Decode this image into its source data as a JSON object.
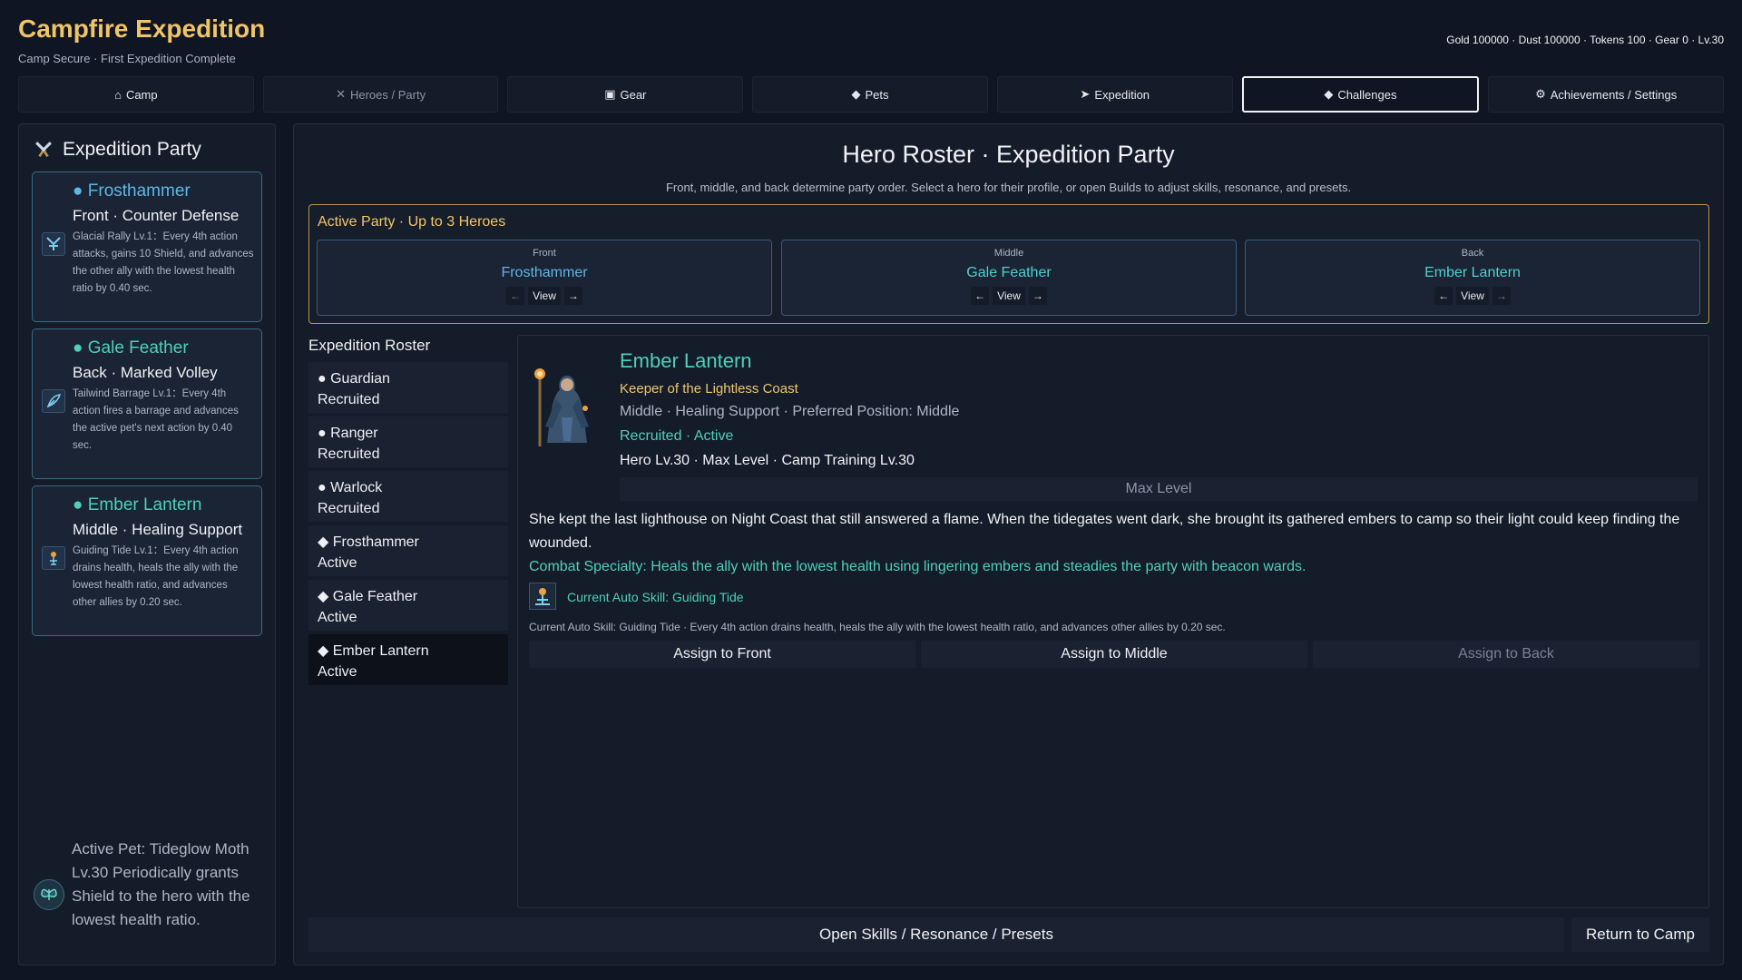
{
  "app": {
    "title": "Campfire Expedition",
    "subtitle": "Camp Secure · First Expedition Complete",
    "resources": "Gold 100000 · Dust 100000 · Tokens 100 · Gear 0 · Lv.30"
  },
  "nav": {
    "tabs": [
      {
        "icon": "⌂",
        "label": "Camp"
      },
      {
        "icon": "✕",
        "label": "Heroes / Party"
      },
      {
        "icon": "▣",
        "label": "Gear"
      },
      {
        "icon": "◆",
        "label": "Pets"
      },
      {
        "icon": "➤",
        "label": "Expedition"
      },
      {
        "icon": "◆",
        "label": "Challenges"
      },
      {
        "icon": "⚙",
        "label": "Achievements / Settings"
      }
    ],
    "active_tab": "Challenges"
  },
  "sidebar": {
    "title": "Expedition Party",
    "cards": [
      {
        "name": "● Frosthammer",
        "role": "Front · Counter Defense",
        "desc": "Glacial Rally Lv.1：Every 4th action attacks, gains 10 Shield, and advances the other ally with the lowest health ratio by 0.40 sec.",
        "icon": "frost-hammer-icon"
      },
      {
        "name": "● Gale Feather",
        "role": "Back · Marked Volley",
        "desc": "Tailwind Barrage Lv.1：Every 4th action fires a barrage and advances the active pet's next action by 0.40 sec.",
        "icon": "feather-icon"
      },
      {
        "name": "● Ember Lantern",
        "role": "Middle · Healing Support",
        "desc": "Guiding Tide Lv.1：Every 4th action drains health, heals the ally with the lowest health ratio, and advances other allies by 0.20 sec.",
        "icon": "lantern-icon"
      }
    ],
    "pet": {
      "text": "Active Pet: Tideglow Moth Lv.30 Periodically grants Shield to the hero with the lowest health ratio.",
      "icon": "moth-icon"
    }
  },
  "main": {
    "title": "Hero Roster · Expedition Party",
    "subtitle": "Front, middle, and back determine party order. Select a hero for their profile, or open Builds to adjust skills, resonance, and presets.",
    "active_party": {
      "title": "Active Party · Up to 3 Heroes",
      "slots": [
        {
          "label": "Front",
          "name": "Frosthammer",
          "left": "←",
          "view": "View",
          "right": "→"
        },
        {
          "label": "Middle",
          "name": "Gale Feather",
          "left": "←",
          "view": "View",
          "right": "→"
        },
        {
          "label": "Back",
          "name": "Ember Lantern",
          "left": "←",
          "view": "View",
          "right": "→"
        }
      ]
    },
    "roster": {
      "title": "Expedition Roster",
      "items": [
        {
          "name": "● Guardian",
          "status": "Recruited"
        },
        {
          "name": "● Ranger",
          "status": "Recruited"
        },
        {
          "name": "● Warlock",
          "status": "Recruited"
        },
        {
          "name": "◆ Frosthammer",
          "status": "Active"
        },
        {
          "name": "◆ Gale Feather",
          "status": "Active"
        },
        {
          "name": "◆ Ember Lantern",
          "status": "Active"
        }
      ]
    },
    "detail": {
      "name": "Ember Lantern",
      "title": "Keeper of the Lightless Coast",
      "role": "Middle · Healing Support · Preferred Position: Middle",
      "status": "Recruited · Active",
      "level": "Hero Lv.30 · Max Level · Camp Training Lv.30",
      "max_level": "Max Level",
      "story": "She kept the last lighthouse on Night Coast that still answered a flame. When the tidegates went dark, she brought its gathered embers to camp so their light could keep finding the wounded.",
      "specialty": "Combat Specialty: Heals the ally with the lowest health using lingering embers and steadies the party with beacon wards.",
      "skill_label": "Current Auto Skill: Guiding Tide",
      "skill_desc": "Current Auto Skill: Guiding Tide · Every 4th action drains health, heals the ally with the lowest health ratio, and advances other allies by 0.20 sec.",
      "assign": [
        "Assign to Front",
        "Assign to Middle",
        "Assign to Back"
      ]
    },
    "bottom": {
      "skills": "Open Skills / Resonance / Presets",
      "return": "Return to Camp"
    }
  },
  "colors": {
    "accent_gold": "#f0c56a",
    "accent_teal": "#4fd0b8",
    "accent_blue": "#5fb6e6",
    "background": "#0f1522"
  }
}
